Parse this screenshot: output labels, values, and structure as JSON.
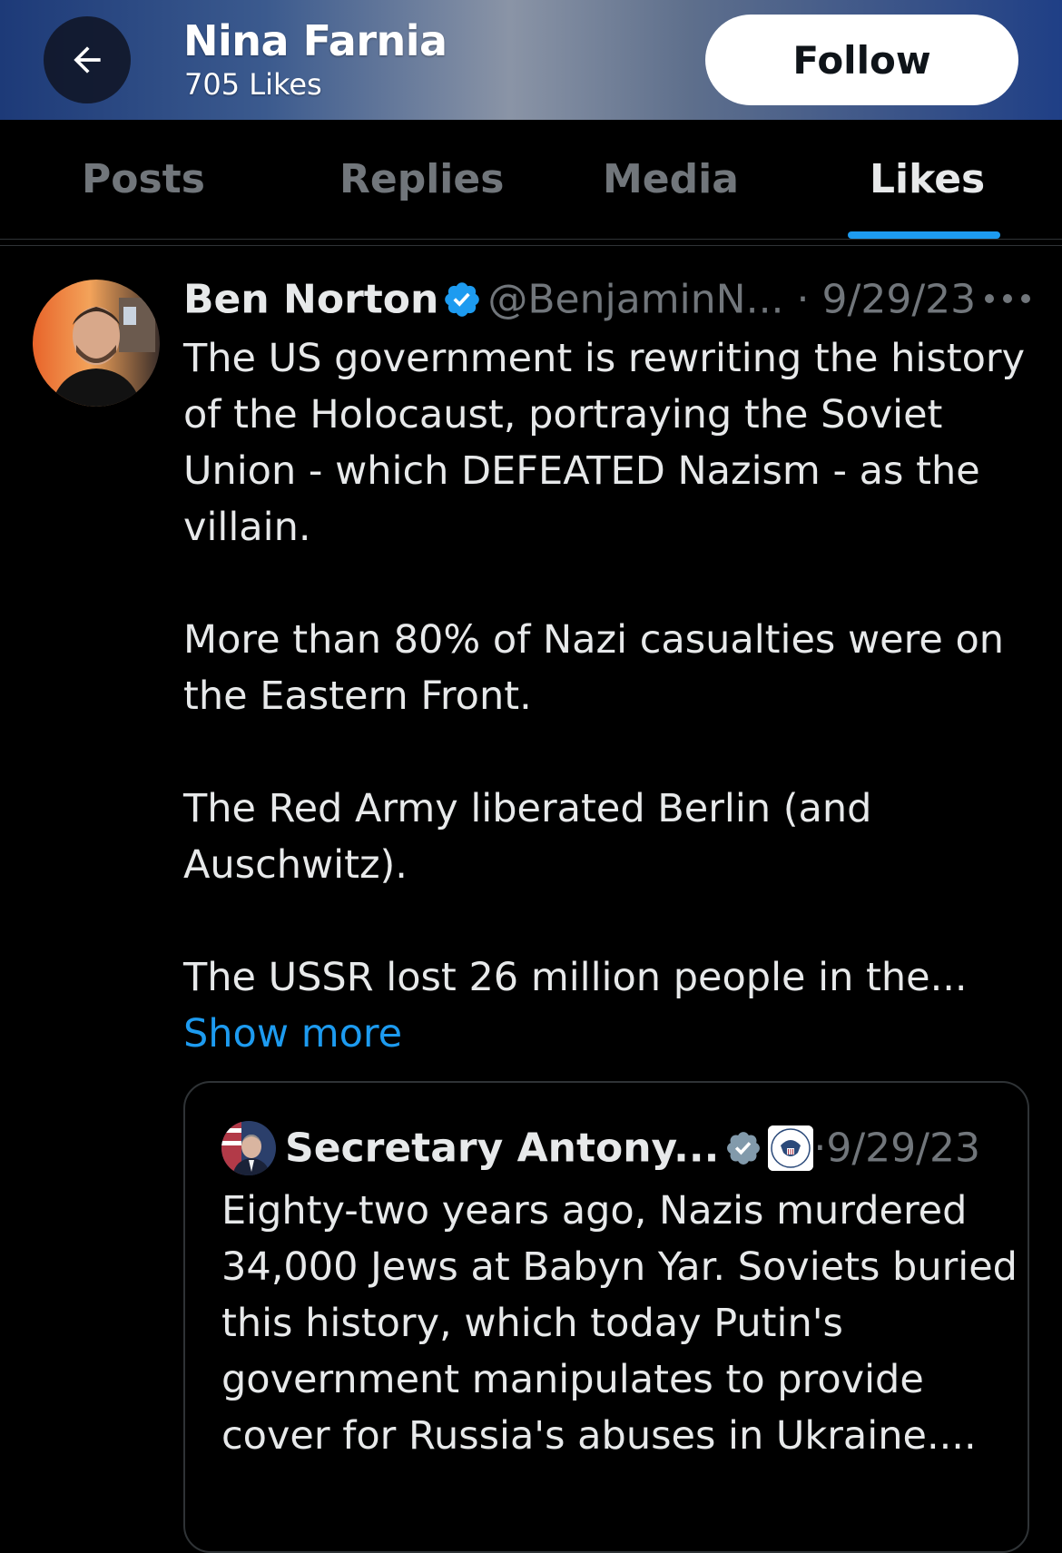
{
  "header": {
    "name": "Nina Farnia",
    "subtitle": "705 Likes",
    "follow_label": "Follow"
  },
  "tabs": [
    {
      "label": "Posts",
      "active": false
    },
    {
      "label": "Replies",
      "active": false
    },
    {
      "label": "Media",
      "active": false
    },
    {
      "label": "Likes",
      "active": true
    }
  ],
  "tweet": {
    "author": "Ben Norton",
    "handle": "@BenjaminN...",
    "separator": "·",
    "date": "9/29/23",
    "paragraphs": [
      "The US government is rewriting the history of the Holocaust, portraying the Soviet Union - which DEFEATED Nazism - as the villain.",
      "More than 80% of Nazi casualties were on the Eastern Front.",
      "The Red Army liberated Berlin (and Auschwitz)."
    ],
    "truncated_text": "The USSR lost 26 million people in the...",
    "show_more": "Show more"
  },
  "quote": {
    "author": "Secretary Antony...",
    "separator": "·",
    "date": "9/29/23",
    "text": "Eighty-two years ago, Nazis murdered 34,000 Jews at Babyn Yar. Soviets buried this history, which today Putin's government manipulates to provide cover for Russia's abuses in Ukraine...."
  },
  "colors": {
    "accent": "#1d9bf0",
    "background": "#000000",
    "text": "#e7e9ea",
    "muted": "#71767b",
    "border": "#2f3336"
  },
  "icons": {
    "back": "arrow-left-icon",
    "verified": "verified-badge-icon",
    "government_verified": "gray-check-icon",
    "seal": "us-seal-icon",
    "more": "more-horizontal-icon"
  }
}
